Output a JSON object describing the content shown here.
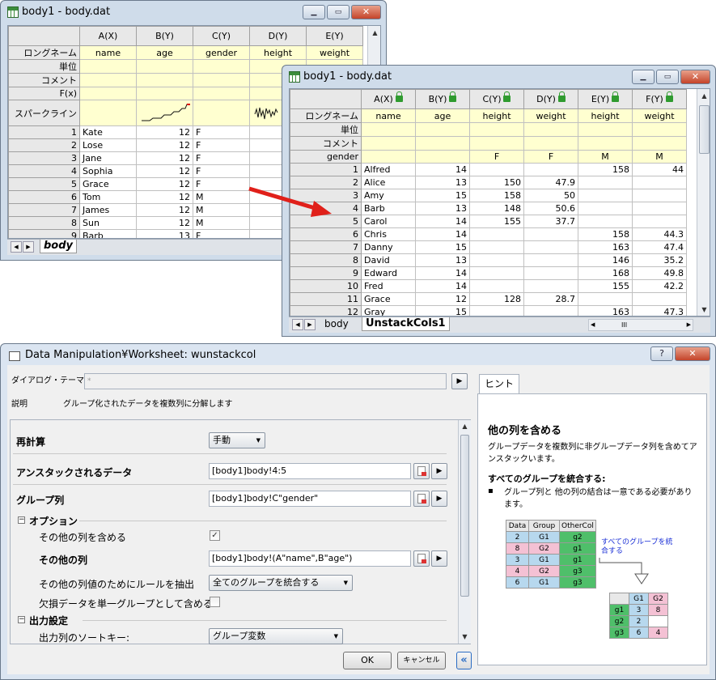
{
  "win1": {
    "title": "body1 - body.dat",
    "cols": [
      "A(X)",
      "B(Y)",
      "C(Y)",
      "D(Y)",
      "E(Y)"
    ],
    "row_labels": [
      "ロングネーム",
      "単位",
      "コメント",
      "F(x)",
      "スパークライン"
    ],
    "longnames": [
      "name",
      "age",
      "gender",
      "height",
      "weight"
    ],
    "rows": [
      [
        "1",
        "Kate",
        "12",
        "F"
      ],
      [
        "2",
        "Lose",
        "12",
        "F"
      ],
      [
        "3",
        "Jane",
        "12",
        "F"
      ],
      [
        "4",
        "Sophia",
        "12",
        "F"
      ],
      [
        "5",
        "Grace",
        "12",
        "F"
      ],
      [
        "6",
        "Tom",
        "12",
        "M"
      ],
      [
        "7",
        "James",
        "12",
        "M"
      ],
      [
        "8",
        "Sun",
        "12",
        "M"
      ],
      [
        "9",
        "Barb",
        "13",
        "F"
      ]
    ],
    "tab": "body"
  },
  "win2": {
    "title": "body1 - body.dat",
    "cols": [
      "A(X)",
      "B(Y)",
      "C(Y)",
      "D(Y)",
      "E(Y)",
      "F(Y)"
    ],
    "row_labels": [
      "ロングネーム",
      "単位",
      "コメント",
      "gender"
    ],
    "longnames": [
      "name",
      "age",
      "height",
      "weight",
      "height",
      "weight"
    ],
    "gender_row": [
      "",
      "",
      "F",
      "F",
      "M",
      "M"
    ],
    "rows": [
      [
        "1",
        "Alfred",
        "14",
        "",
        "",
        "158",
        "44"
      ],
      [
        "2",
        "Alice",
        "13",
        "150",
        "47.9",
        "",
        ""
      ],
      [
        "3",
        "Amy",
        "15",
        "158",
        "50",
        "",
        ""
      ],
      [
        "4",
        "Barb",
        "13",
        "148",
        "50.6",
        "",
        ""
      ],
      [
        "5",
        "Carol",
        "14",
        "155",
        "37.7",
        "",
        ""
      ],
      [
        "6",
        "Chris",
        "14",
        "",
        "",
        "158",
        "44.3"
      ],
      [
        "7",
        "Danny",
        "15",
        "",
        "",
        "163",
        "47.4"
      ],
      [
        "8",
        "David",
        "13",
        "",
        "",
        "146",
        "35.2"
      ],
      [
        "9",
        "Edward",
        "14",
        "",
        "",
        "168",
        "49.8"
      ],
      [
        "10",
        "Fred",
        "14",
        "",
        "",
        "155",
        "42.2"
      ],
      [
        "11",
        "Grace",
        "12",
        "128",
        "28.7",
        "",
        ""
      ],
      [
        "12",
        "Gray",
        "15",
        "",
        "",
        "163",
        "47.3"
      ]
    ],
    "tabs": [
      "body",
      "UnstackCols1"
    ],
    "hscroll_grip": "III"
  },
  "dialog": {
    "title": "Data Manipulation¥Worksheet: wunstackcol",
    "theme_label": "ダイアログ・テーマ(H)",
    "theme_value": "*",
    "desc_label": "説明",
    "desc_value": "グループ化されたデータを複数列に分解します",
    "recalc_label": "再計算",
    "recalc_value": "手動",
    "unstack_label": "アンスタックされるデータ",
    "unstack_value": "[body1]body!4:5",
    "group_label": "グループ列",
    "group_value": "[body1]body!C\"gender\"",
    "options_label": "オプション",
    "include_label": "その他の列を含める",
    "include_checked": true,
    "other_label": "その他の列",
    "other_value": "[body1]body!(A\"name\",B\"age\")",
    "rule_label": "その他の列値のためにルールを抽出",
    "rule_value": "全てのグループを統合する",
    "missing_label": "欠損データを単一グループとして含める",
    "missing_checked": false,
    "output_label": "出力設定",
    "sortkey_label": "出力列のソートキー:",
    "sortkey_value": "グループ変数",
    "ok": "OK",
    "cancel": "キャンセル",
    "help_btn": "?",
    "collapse_glyph": "«"
  },
  "hint": {
    "tab": "ヒント",
    "h1": "他の列を含める",
    "p1": "グループデータを複数列に非グループデータ列を含めてアンスタックいます。",
    "h2": "すべてのグループを統合する:",
    "bullet": "グループ列と 他の列の結合は一意である必要があります。",
    "annot": "すべてのグループを統合する",
    "t1_head": [
      "Data",
      "Group",
      "OtherCol"
    ],
    "t1_rows": [
      [
        "2",
        "G1",
        "g2"
      ],
      [
        "8",
        "G2",
        "g1"
      ],
      [
        "3",
        "G1",
        "g1"
      ],
      [
        "4",
        "G2",
        "g3"
      ],
      [
        "6",
        "G1",
        "g3"
      ]
    ],
    "t2_head": [
      "",
      "G1",
      "G2"
    ],
    "t2_rows": [
      [
        "g1",
        "3",
        "8"
      ],
      [
        "g2",
        "2",
        ""
      ],
      [
        "g3",
        "6",
        "4"
      ]
    ]
  },
  "colors": {
    "dialog_bg": "#dbe5f1",
    "grid_header": "#e8e8e8",
    "longname_bg": "#ffffd0",
    "arrow": "#e0201a",
    "lock": "#2f9b2f"
  }
}
